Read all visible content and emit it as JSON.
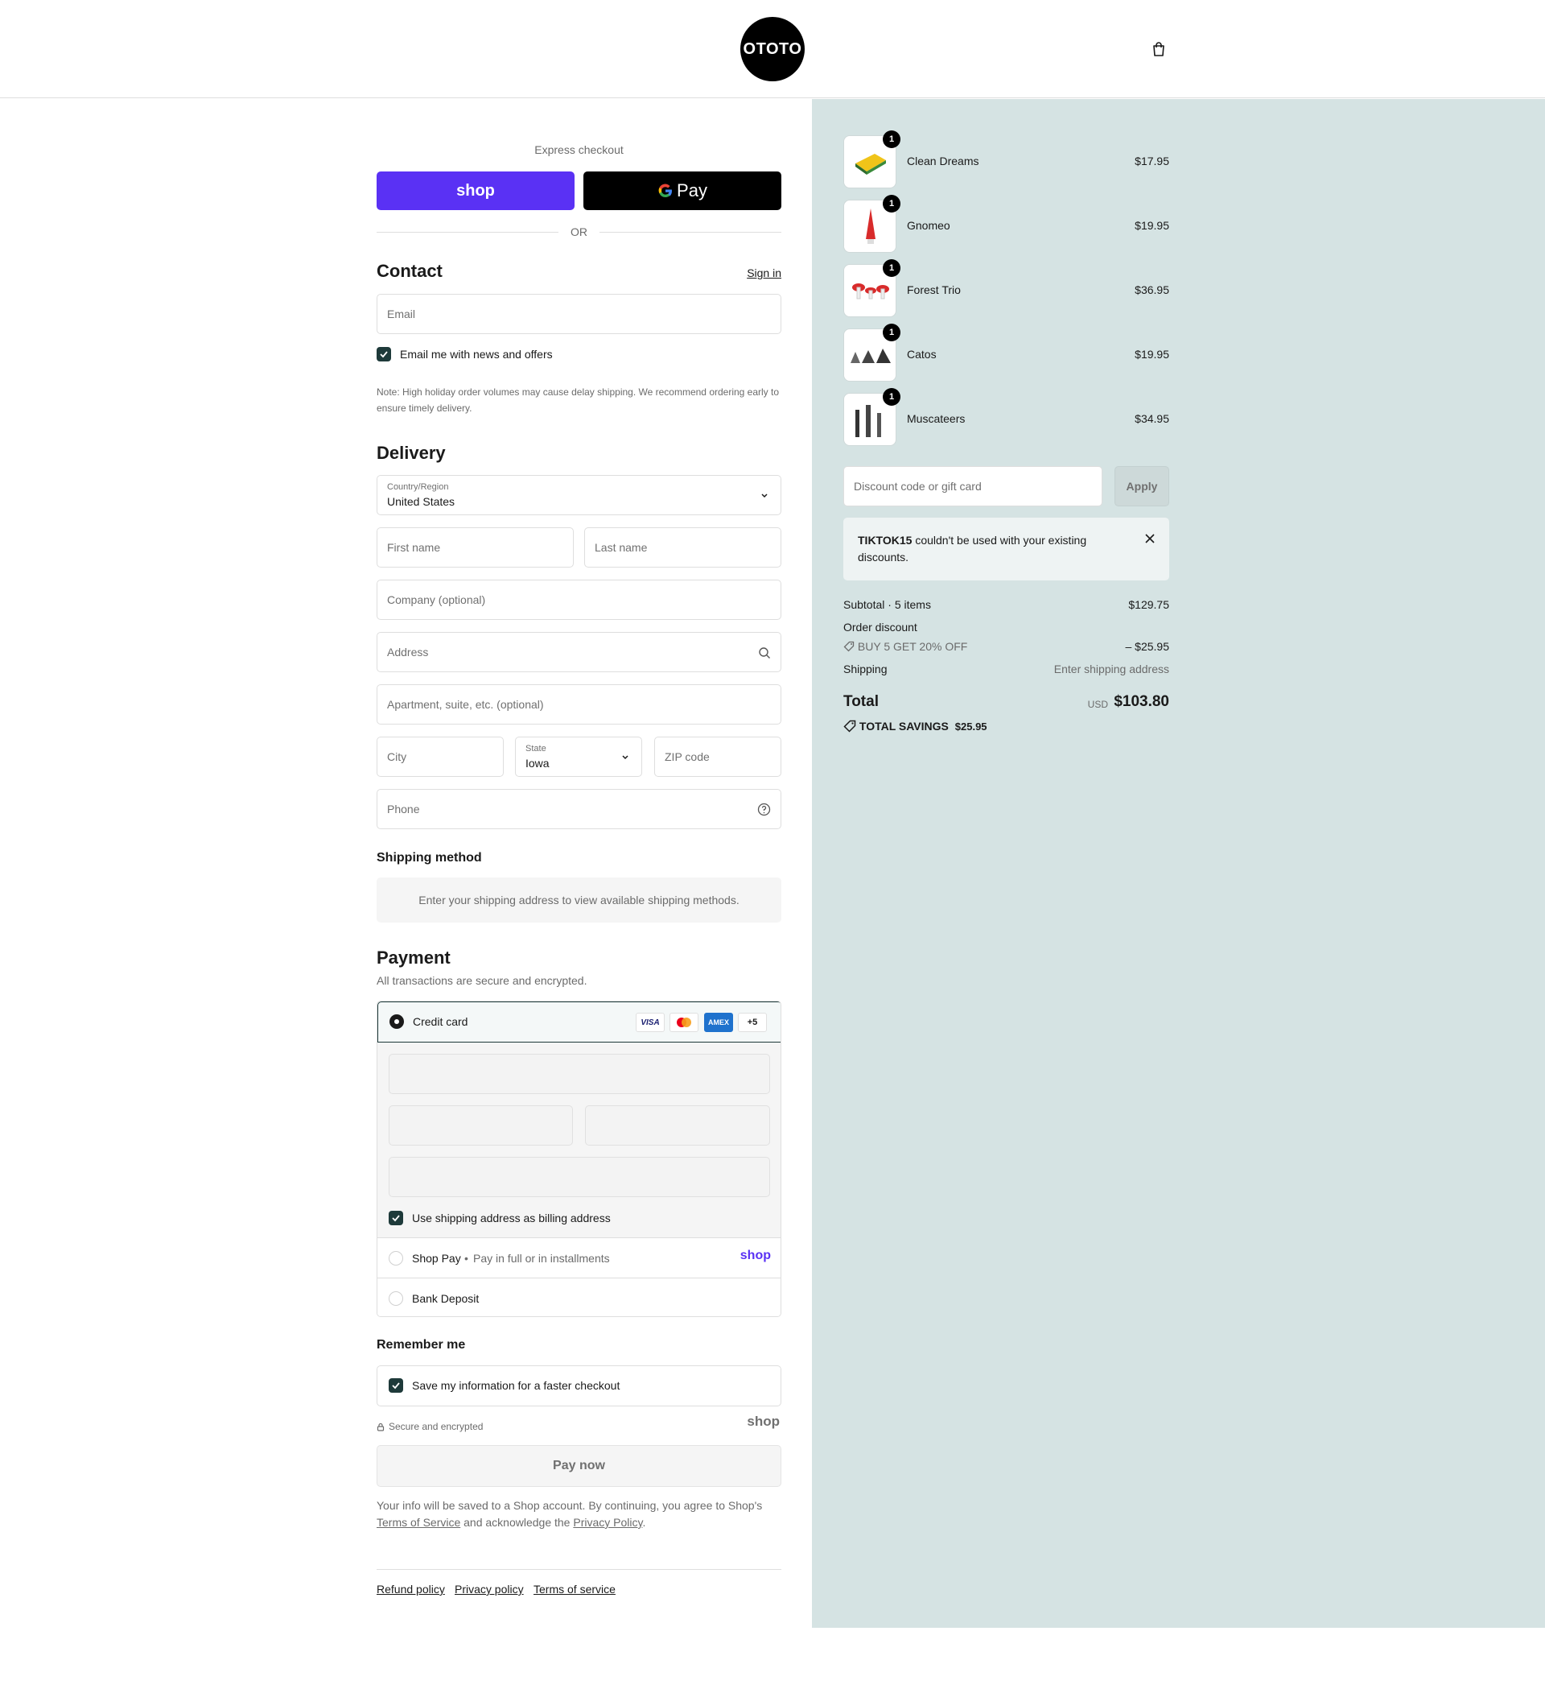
{
  "header": {
    "logo_text": "OTOTO",
    "bag_icon": "shopping-bag-icon"
  },
  "express": {
    "label": "Express checkout",
    "shop_pay_label": "shop",
    "gpay_label": "Pay",
    "or_label": "OR"
  },
  "contact": {
    "title": "Contact",
    "sign_in": "Sign in",
    "email_placeholder": "Email",
    "news_label": "Email me with news and offers",
    "news_checked": true,
    "note": "Note: High holiday order volumes may cause delay shipping. We recommend ordering early to ensure timely delivery."
  },
  "delivery": {
    "title": "Delivery",
    "country_label": "Country/Region",
    "country_value": "United States",
    "first_name": "First name",
    "last_name": "Last name",
    "company": "Company (optional)",
    "address": "Address",
    "apartment": "Apartment, suite, etc. (optional)",
    "city": "City",
    "state_label": "State",
    "state_value": "Iowa",
    "zip": "ZIP code",
    "phone": "Phone"
  },
  "shipping_method": {
    "title": "Shipping method",
    "message": "Enter your shipping address to view available shipping methods."
  },
  "payment": {
    "title": "Payment",
    "subtitle": "All transactions are secure and encrypted.",
    "credit_card_label": "Credit card",
    "card_brands": [
      "VISA",
      "MC",
      "AMEX"
    ],
    "more_cards": "+5",
    "billing_same_label": "Use shipping address as billing address",
    "shop_pay_label": "Shop Pay",
    "shop_pay_desc": "Pay in full or in installments",
    "shop_pay_logo": "shop",
    "bank_label": "Bank Deposit"
  },
  "remember": {
    "title": "Remember me",
    "save_label": "Save my information for a faster checkout",
    "secure_label": "Secure and encrypted",
    "shop_logo": "shop"
  },
  "pay_now": "Pay now",
  "legal": {
    "part1": "Your info will be saved to a Shop account. By continuing, you agree to Shop's",
    "terms": "Terms of Service",
    "part2": "and acknowledge the",
    "privacy": "Privacy Policy",
    "end": "."
  },
  "footer": {
    "refund": "Refund policy",
    "privacy": "Privacy policy",
    "terms": "Terms of service"
  },
  "cart": {
    "items": [
      {
        "name": "Clean Dreams",
        "price": "$17.95",
        "qty": "1"
      },
      {
        "name": "Gnomeo",
        "price": "$19.95",
        "qty": "1"
      },
      {
        "name": "Forest Trio",
        "price": "$36.95",
        "qty": "1"
      },
      {
        "name": "Catos",
        "price": "$19.95",
        "qty": "1"
      },
      {
        "name": "Muscateers",
        "price": "$34.95",
        "qty": "1"
      }
    ],
    "discount_placeholder": "Discount code or gift card",
    "apply": "Apply",
    "error_code": "TIKTOK15",
    "error_text": "couldn't be used with your existing discounts.",
    "subtotal_label": "Subtotal · 5 items",
    "subtotal": "$129.75",
    "order_discount_label": "Order discount",
    "discount_name": "BUY 5 GET 20% OFF",
    "discount_value": "– $25.95",
    "shipping_label": "Shipping",
    "shipping_value": "Enter shipping address",
    "total_label": "Total",
    "currency": "USD",
    "total": "$103.80",
    "savings_label": "TOTAL SAVINGS",
    "savings": "$25.95"
  },
  "colors": {
    "accent": "#1e3a3a",
    "shop_purple": "#5a31f4",
    "sidebar_bg": "#d5e3e3"
  }
}
